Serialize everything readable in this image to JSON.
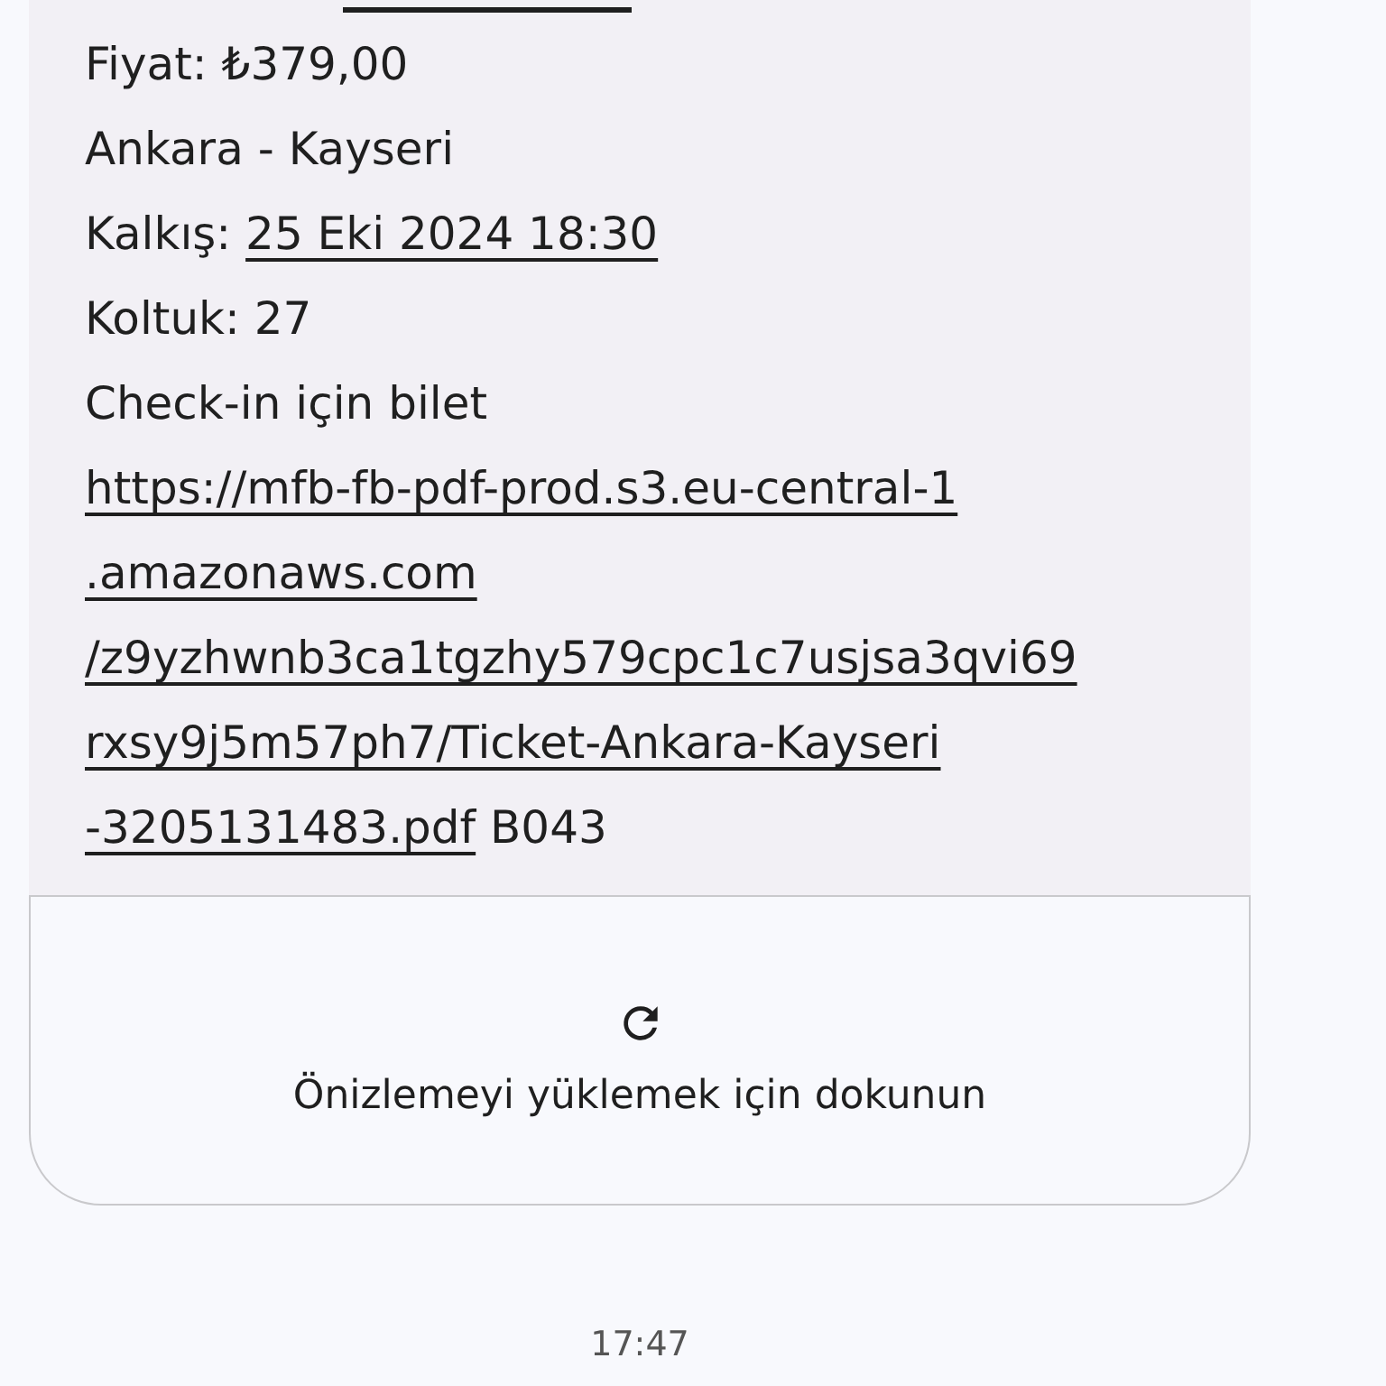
{
  "message": {
    "lines": [
      [
        {
          "text": "Fiyat: ₺379,00",
          "link": false
        }
      ],
      [
        {
          "text": "Ankara - Kayseri",
          "link": false
        }
      ],
      [
        {
          "text": "Kalkış: ",
          "link": false
        },
        {
          "text": "25 Eki 2024 18:30",
          "link": true
        }
      ],
      [
        {
          "text": "Koltuk: 27",
          "link": false
        }
      ],
      [
        {
          "text": "Check-in için bilet",
          "link": false
        }
      ],
      [
        {
          "text": "https://mfb-fb-pdf-prod.s3.eu-central-1",
          "link": true
        }
      ],
      [
        {
          "text": ".amazonaws.com",
          "link": true
        }
      ],
      [
        {
          "text": "/z9yzhwnb3ca1tgzhy579cpc1c7usjsa3qvi69",
          "link": true
        }
      ],
      [
        {
          "text": "rxsy9j5m57ph7/Ticket-Ankara-Kayseri",
          "link": true
        }
      ],
      [
        {
          "text": "-3205131483.pdf",
          "link": true
        },
        {
          "text": " B043",
          "link": false
        }
      ]
    ]
  },
  "preview": {
    "label": "Önizlemeyi yüklemek için dokunun"
  },
  "timestamp": "17:47"
}
